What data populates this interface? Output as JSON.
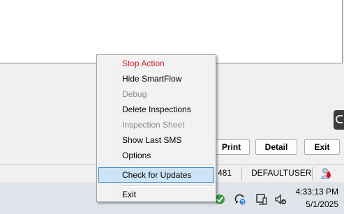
{
  "app": {
    "buttons": {
      "print": "Print",
      "detail": "Detail",
      "exit": "Exit"
    },
    "status": {
      "number": "481",
      "user": "DEFAULTUSER"
    }
  },
  "context_menu": {
    "items": [
      {
        "label": "Stop Action",
        "state": "accent"
      },
      {
        "label": "Hide SmartFlow",
        "state": "normal"
      },
      {
        "label": "Debug",
        "state": "disabled"
      },
      {
        "label": "Delete Inspections",
        "state": "normal"
      },
      {
        "label": "Inspection Sheet",
        "state": "disabled"
      },
      {
        "label": "Show Last SMS",
        "state": "normal"
      },
      {
        "label": "Options",
        "state": "normal"
      },
      {
        "label": "Check for Updates",
        "state": "highlighted"
      },
      {
        "label": "Exit",
        "state": "normal"
      }
    ]
  },
  "taskbar": {
    "time": "4:33:13 PM",
    "date": "5/1/2025",
    "icons": [
      "smartflow-tray-icon",
      "sync-icon",
      "network-icon",
      "volume-muted-icon"
    ]
  },
  "colors": {
    "accent_text": "#d01f1f",
    "highlight_bg": "#cce4f7",
    "highlight_border": "#3b88c8",
    "disabled_text": "#8c8c8c"
  }
}
